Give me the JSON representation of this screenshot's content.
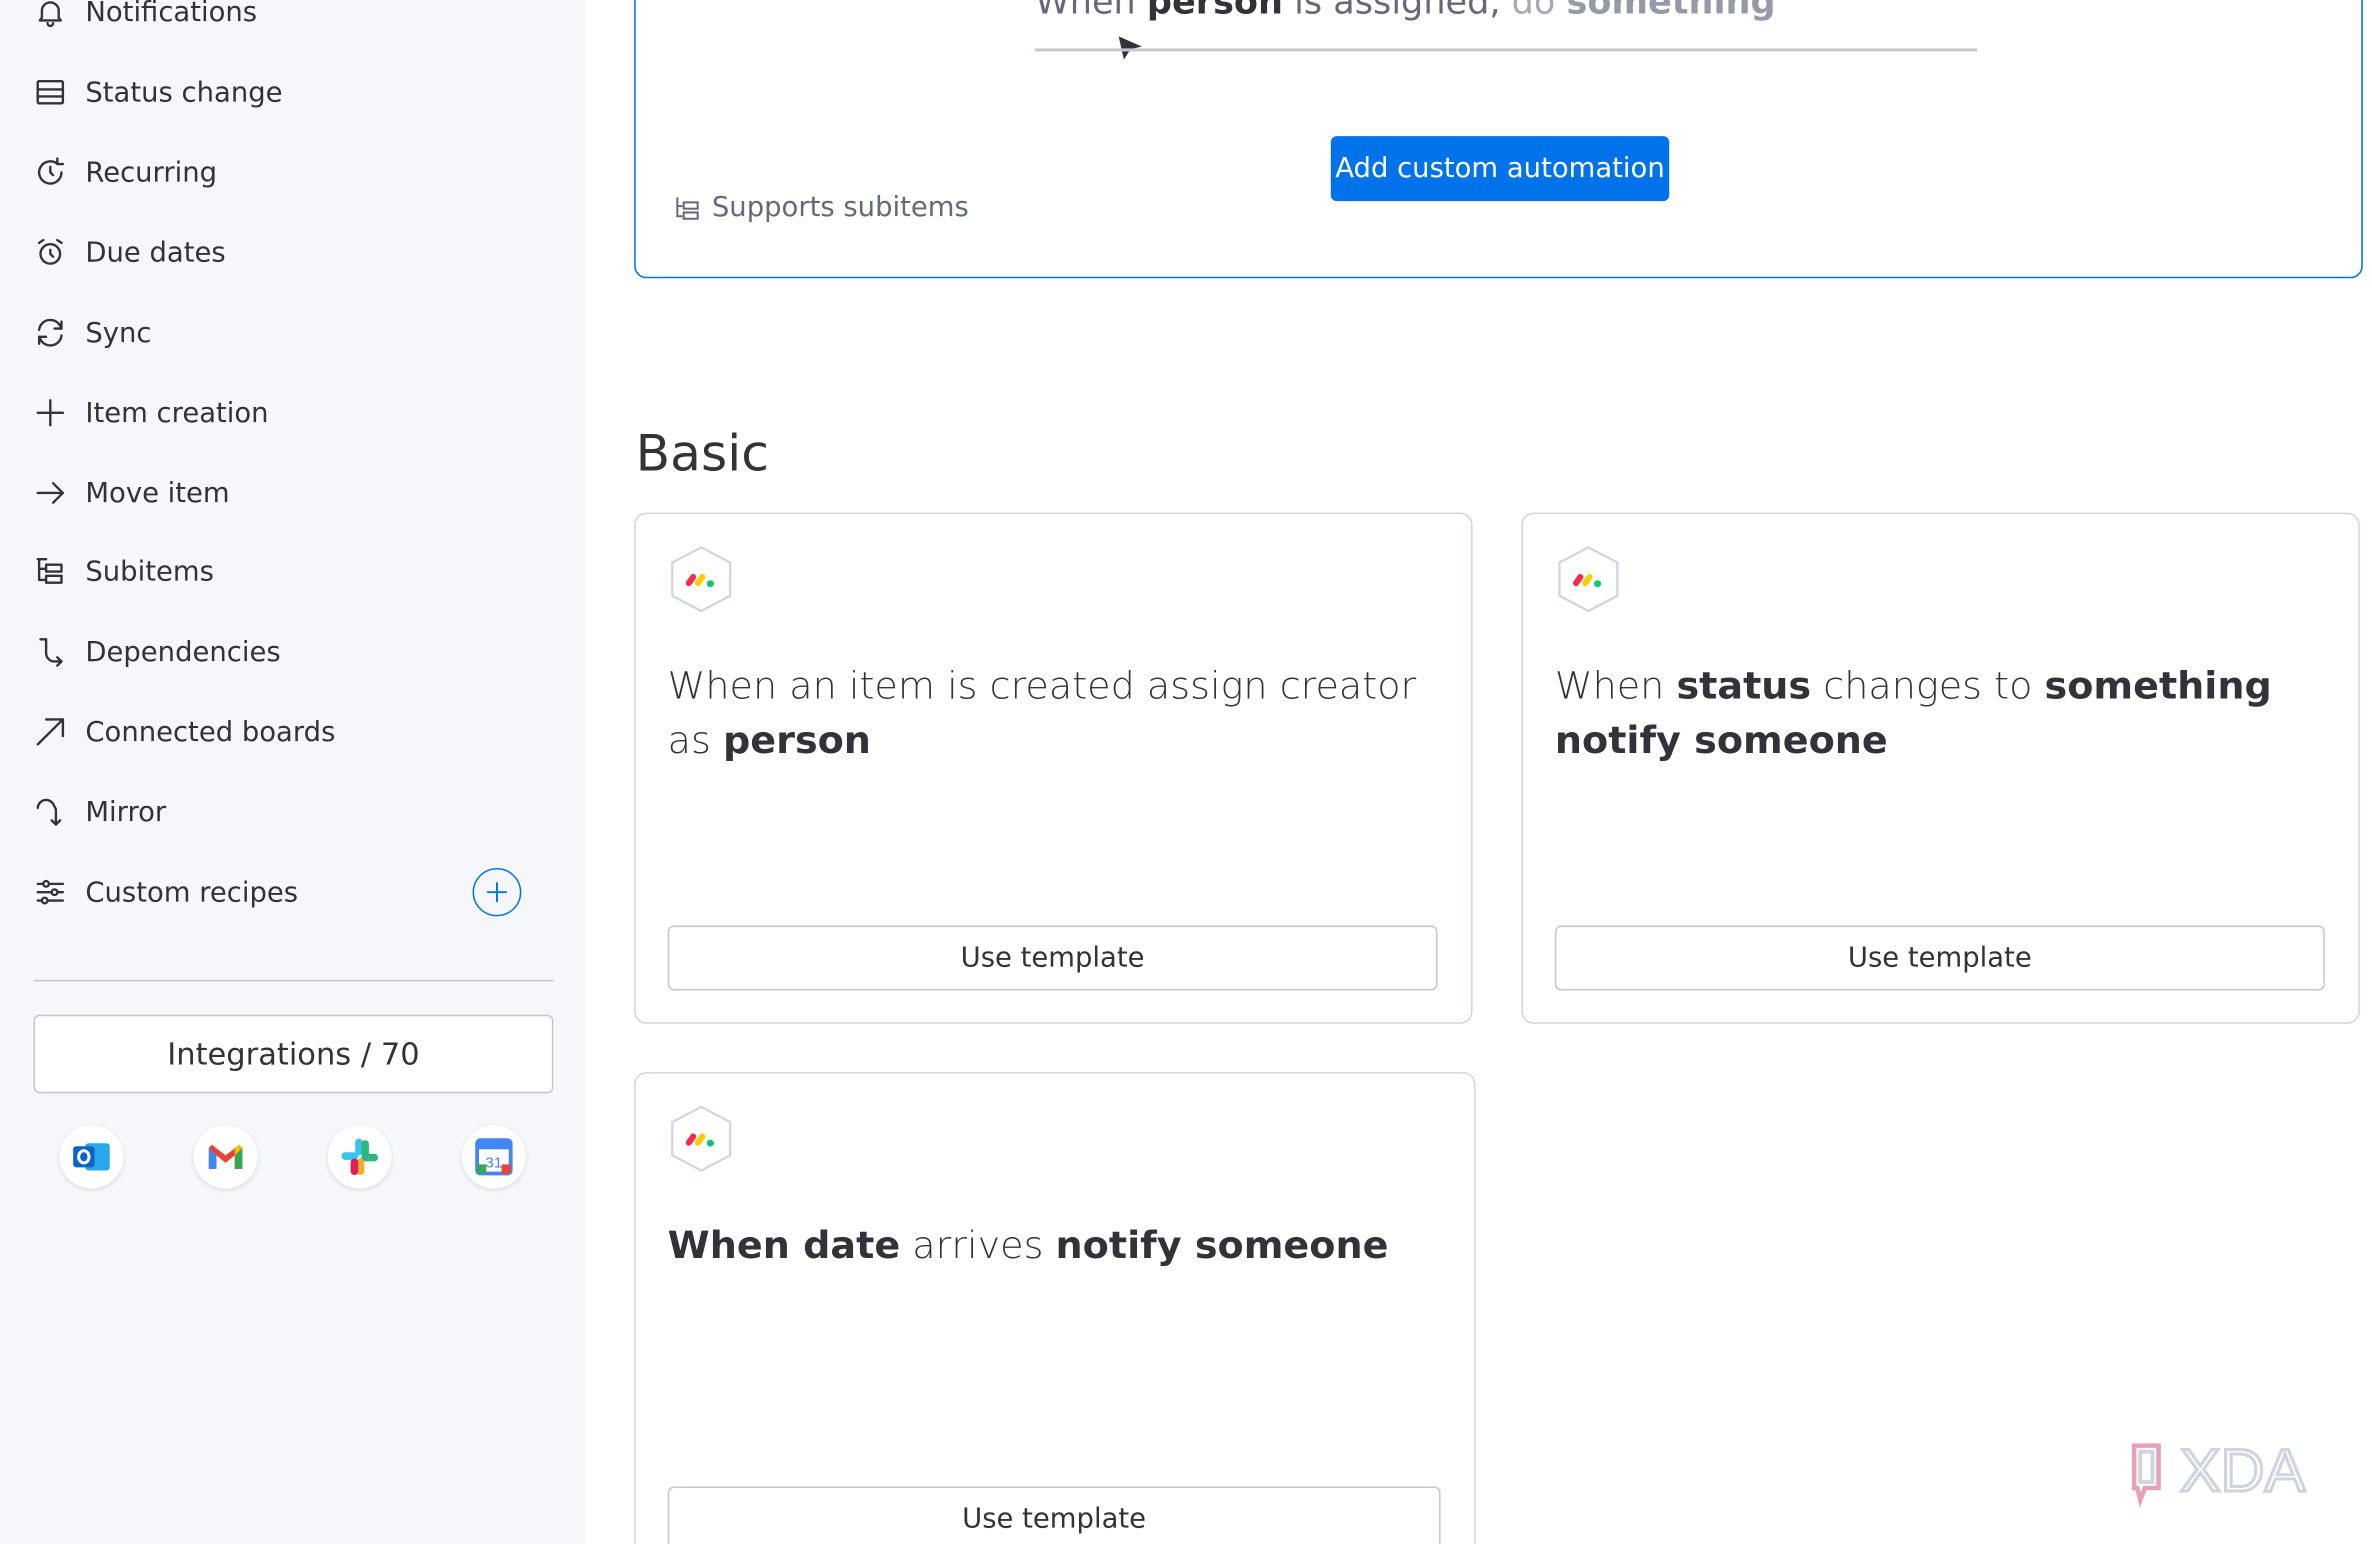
{
  "sidebar": {
    "items": [
      {
        "label": "Notifications",
        "icon": "bell-icon"
      },
      {
        "label": "Status change",
        "icon": "status-icon"
      },
      {
        "label": "Recurring",
        "icon": "recurring-icon"
      },
      {
        "label": "Due dates",
        "icon": "alarm-icon"
      },
      {
        "label": "Sync",
        "icon": "sync-icon"
      },
      {
        "label": "Item creation",
        "icon": "plus-icon"
      },
      {
        "label": "Move item",
        "icon": "arrow-right-icon"
      },
      {
        "label": "Subitems",
        "icon": "subitems-icon"
      },
      {
        "label": "Dependencies",
        "icon": "dependencies-icon"
      },
      {
        "label": "Connected boards",
        "icon": "arrow-up-right-icon"
      },
      {
        "label": "Mirror",
        "icon": "mirror-icon"
      },
      {
        "label": "Custom recipes",
        "icon": "sliders-icon"
      }
    ],
    "integrations_label": "Integrations / 70",
    "integration_apps": [
      "Outlook",
      "Gmail",
      "Slack",
      "Google Calendar"
    ]
  },
  "custom_automation": {
    "sentence_parts": {
      "when": "When",
      "person": "person",
      "is_assigned": "is assigned,",
      "do": "do",
      "something": "something"
    },
    "add_button": "Add custom automation",
    "supports_subitems": "Supports subitems"
  },
  "basic": {
    "title": "Basic",
    "templates": [
      {
        "parts": [
          {
            "t": "When an item is created assign creator as ",
            "b": false
          },
          {
            "t": "person",
            "b": true
          }
        ],
        "button": "Use template"
      },
      {
        "parts": [
          {
            "t": "When ",
            "b": false
          },
          {
            "t": "status",
            "b": true
          },
          {
            "t": " changes to ",
            "b": false
          },
          {
            "t": "something notify someone",
            "b": true
          }
        ],
        "button": "Use template"
      },
      {
        "parts": [
          {
            "t": "When date",
            "b": true
          },
          {
            "t": " arrives ",
            "b": false
          },
          {
            "t": "notify someone",
            "b": true
          }
        ],
        "button": "Use template"
      }
    ]
  },
  "colors": {
    "accent": "#0073ea",
    "sidebar_bg": "#f6f7fb",
    "text": "#323338"
  },
  "watermark": "XDA"
}
